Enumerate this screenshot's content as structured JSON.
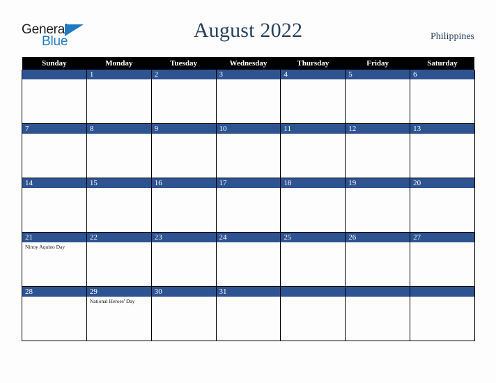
{
  "brand": {
    "name_top": "General",
    "name_bottom": "Blue",
    "triangle_icon": "blue-triangle-icon",
    "color_dark": "#1c1c1c",
    "color_blue": "#1f7ac4"
  },
  "header": {
    "title": "August 2022",
    "country": "Philippines",
    "title_color": "#27405f"
  },
  "calendar": {
    "month": "August",
    "year": "2022",
    "weekday_headers": [
      "Sunday",
      "Monday",
      "Tuesday",
      "Wednesday",
      "Thursday",
      "Friday",
      "Saturday"
    ],
    "colors": {
      "header_bg": "#000000",
      "header_text": "#ffffff",
      "date_band": "#2e5391",
      "date_text": "#ffffff",
      "grid_line": "#000000",
      "cell_bg": "#fdfdfd"
    },
    "weeks": [
      [
        {
          "date": "",
          "events": []
        },
        {
          "date": "1",
          "events": []
        },
        {
          "date": "2",
          "events": []
        },
        {
          "date": "3",
          "events": []
        },
        {
          "date": "4",
          "events": []
        },
        {
          "date": "5",
          "events": []
        },
        {
          "date": "6",
          "events": []
        }
      ],
      [
        {
          "date": "7",
          "events": []
        },
        {
          "date": "8",
          "events": []
        },
        {
          "date": "9",
          "events": []
        },
        {
          "date": "10",
          "events": []
        },
        {
          "date": "11",
          "events": []
        },
        {
          "date": "12",
          "events": []
        },
        {
          "date": "13",
          "events": []
        }
      ],
      [
        {
          "date": "14",
          "events": []
        },
        {
          "date": "15",
          "events": []
        },
        {
          "date": "16",
          "events": []
        },
        {
          "date": "17",
          "events": []
        },
        {
          "date": "18",
          "events": []
        },
        {
          "date": "19",
          "events": []
        },
        {
          "date": "20",
          "events": []
        }
      ],
      [
        {
          "date": "21",
          "events": [
            "Ninoy Aquino Day"
          ]
        },
        {
          "date": "22",
          "events": []
        },
        {
          "date": "23",
          "events": []
        },
        {
          "date": "24",
          "events": []
        },
        {
          "date": "25",
          "events": []
        },
        {
          "date": "26",
          "events": []
        },
        {
          "date": "27",
          "events": []
        }
      ],
      [
        {
          "date": "28",
          "events": []
        },
        {
          "date": "29",
          "events": [
            "National Heroes' Day"
          ]
        },
        {
          "date": "30",
          "events": []
        },
        {
          "date": "31",
          "events": []
        },
        {
          "date": "",
          "events": []
        },
        {
          "date": "",
          "events": []
        },
        {
          "date": "",
          "events": []
        }
      ]
    ]
  }
}
